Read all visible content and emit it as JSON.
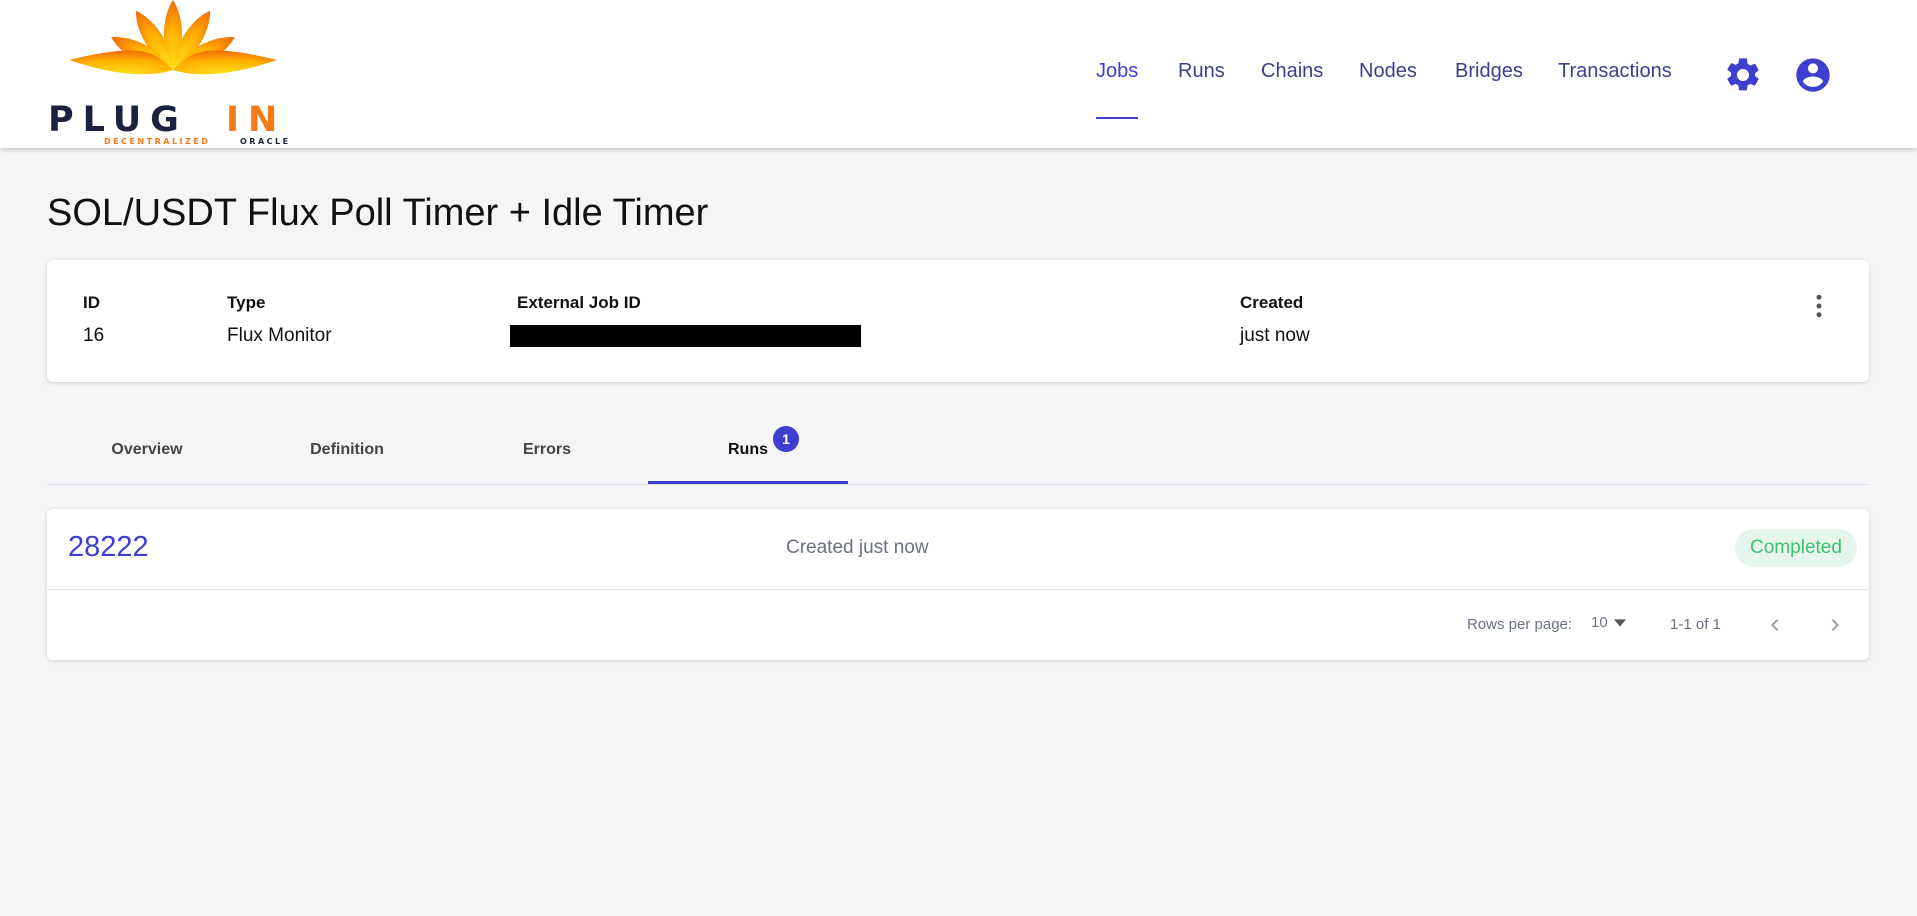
{
  "brand": {
    "logo_word_dark": "PLUG",
    "logo_word_accent": "IN",
    "logo_tagline_left": "DECENTRALIZED",
    "logo_tagline_right": "ORACLE",
    "colors": {
      "navy": "#1c2140",
      "orange": "#f47a16",
      "yellow": "#ffd41c"
    }
  },
  "nav": {
    "items": [
      {
        "label": "Jobs",
        "active": true
      },
      {
        "label": "Runs"
      },
      {
        "label": "Chains"
      },
      {
        "label": "Nodes"
      },
      {
        "label": "Bridges"
      },
      {
        "label": "Transactions"
      }
    ],
    "icons": [
      "gear-icon",
      "account-circle-icon"
    ]
  },
  "page": {
    "title": "SOL/USDT Flux Poll Timer + Idle Timer"
  },
  "job": {
    "id_label": "ID",
    "id_value": "16",
    "type_label": "Type",
    "type_value": "Flux Monitor",
    "external_label": "External Job ID",
    "created_label": "Created",
    "created_value": "just now",
    "menu_icon": "more-vertical-icon"
  },
  "tabs": [
    {
      "label": "Overview"
    },
    {
      "label": "Definition"
    },
    {
      "label": "Errors"
    },
    {
      "label": "Runs",
      "active": true,
      "badge": "1"
    }
  ],
  "runs": {
    "rows": [
      {
        "id": "28222",
        "created": "Created just now",
        "status": "Completed"
      }
    ],
    "pagination": {
      "rows_per_page_label": "Rows per page:",
      "rows_per_page_value": "10",
      "range": "1-1 of 1",
      "prev_icon": "chevron-left-icon",
      "next_icon": "chevron-right-icon"
    }
  },
  "colors": {
    "accent": "#3f3fcf",
    "nav_text": "#3d3f8c",
    "status_green": "#3fbf6f",
    "status_bg": "#e6f6ec"
  }
}
